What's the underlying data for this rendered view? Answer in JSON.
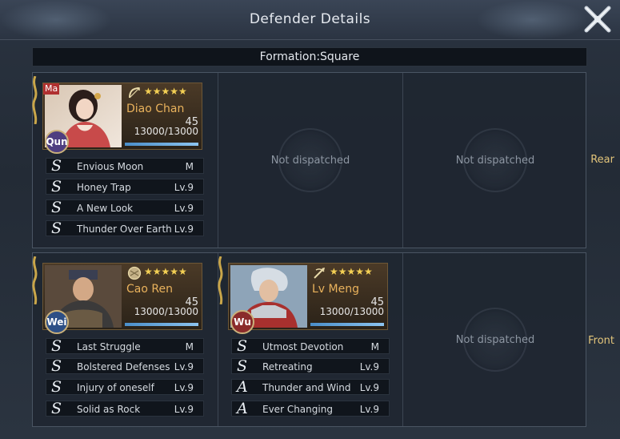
{
  "header": {
    "title": "Defender Details"
  },
  "formation": {
    "label": "Formation:Square"
  },
  "rows": {
    "rear": {
      "label": "Rear"
    },
    "front": {
      "label": "Front"
    }
  },
  "empty_slot_text": "Not dispatched",
  "heroes": {
    "diao_chan": {
      "corner_tag": "Ma",
      "name": "Diao Chan",
      "faction": "Qun",
      "level": "45",
      "troops": "13000/13000",
      "troops_fraction": 1.0,
      "stars": 5,
      "class_icon": "bow-icon",
      "skills": [
        {
          "grade": "S",
          "name": "Envious Moon",
          "level": "M"
        },
        {
          "grade": "S",
          "name": "Honey Trap",
          "level": "Lv.9"
        },
        {
          "grade": "S",
          "name": "A New Look",
          "level": "Lv.9"
        },
        {
          "grade": "S",
          "name": "Thunder Over Earth",
          "level": "Lv.9"
        }
      ]
    },
    "cao_ren": {
      "name": "Cao Ren",
      "faction": "Wei",
      "level": "45",
      "troops": "13000/13000",
      "troops_fraction": 1.0,
      "stars": 5,
      "class_icon": "shield-icon",
      "skills": [
        {
          "grade": "S",
          "name": "Last Struggle",
          "level": "M"
        },
        {
          "grade": "S",
          "name": "Bolstered Defenses",
          "level": "Lv.9"
        },
        {
          "grade": "S",
          "name": "Injury of oneself",
          "level": "Lv.9"
        },
        {
          "grade": "S",
          "name": "Solid as Rock",
          "level": "Lv.9"
        }
      ]
    },
    "lv_meng": {
      "name": "Lv Meng",
      "faction": "Wu",
      "level": "45",
      "troops": "13000/13000",
      "troops_fraction": 1.0,
      "stars": 5,
      "class_icon": "crossbow-icon",
      "skills": [
        {
          "grade": "S",
          "name": "Utmost Devotion",
          "level": "M"
        },
        {
          "grade": "S",
          "name": "Retreating",
          "level": "Lv.9"
        },
        {
          "grade": "A",
          "name": "Thunder and Wind",
          "level": "Lv.9"
        },
        {
          "grade": "A",
          "name": "Ever Changing",
          "level": "Lv.9"
        }
      ]
    }
  },
  "colors": {
    "star": "#f3cf54",
    "hero_name": "#e9b25c",
    "row_label": "#e2c47a",
    "hp_bar": "#4a8ec9"
  }
}
